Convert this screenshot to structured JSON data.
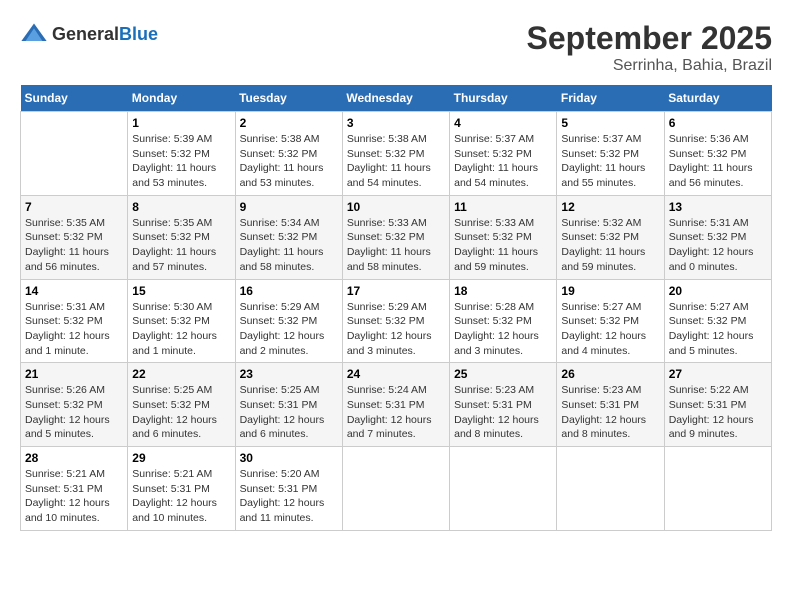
{
  "logo": {
    "text_general": "General",
    "text_blue": "Blue"
  },
  "title": {
    "month": "September 2025",
    "location": "Serrinha, Bahia, Brazil"
  },
  "weekdays": [
    "Sunday",
    "Monday",
    "Tuesday",
    "Wednesday",
    "Thursday",
    "Friday",
    "Saturday"
  ],
  "weeks": [
    [
      {
        "day": "",
        "info": ""
      },
      {
        "day": "1",
        "info": "Sunrise: 5:39 AM\nSunset: 5:32 PM\nDaylight: 11 hours\nand 53 minutes."
      },
      {
        "day": "2",
        "info": "Sunrise: 5:38 AM\nSunset: 5:32 PM\nDaylight: 11 hours\nand 53 minutes."
      },
      {
        "day": "3",
        "info": "Sunrise: 5:38 AM\nSunset: 5:32 PM\nDaylight: 11 hours\nand 54 minutes."
      },
      {
        "day": "4",
        "info": "Sunrise: 5:37 AM\nSunset: 5:32 PM\nDaylight: 11 hours\nand 54 minutes."
      },
      {
        "day": "5",
        "info": "Sunrise: 5:37 AM\nSunset: 5:32 PM\nDaylight: 11 hours\nand 55 minutes."
      },
      {
        "day": "6",
        "info": "Sunrise: 5:36 AM\nSunset: 5:32 PM\nDaylight: 11 hours\nand 56 minutes."
      }
    ],
    [
      {
        "day": "7",
        "info": "Sunrise: 5:35 AM\nSunset: 5:32 PM\nDaylight: 11 hours\nand 56 minutes."
      },
      {
        "day": "8",
        "info": "Sunrise: 5:35 AM\nSunset: 5:32 PM\nDaylight: 11 hours\nand 57 minutes."
      },
      {
        "day": "9",
        "info": "Sunrise: 5:34 AM\nSunset: 5:32 PM\nDaylight: 11 hours\nand 58 minutes."
      },
      {
        "day": "10",
        "info": "Sunrise: 5:33 AM\nSunset: 5:32 PM\nDaylight: 11 hours\nand 58 minutes."
      },
      {
        "day": "11",
        "info": "Sunrise: 5:33 AM\nSunset: 5:32 PM\nDaylight: 11 hours\nand 59 minutes."
      },
      {
        "day": "12",
        "info": "Sunrise: 5:32 AM\nSunset: 5:32 PM\nDaylight: 11 hours\nand 59 minutes."
      },
      {
        "day": "13",
        "info": "Sunrise: 5:31 AM\nSunset: 5:32 PM\nDaylight: 12 hours\nand 0 minutes."
      }
    ],
    [
      {
        "day": "14",
        "info": "Sunrise: 5:31 AM\nSunset: 5:32 PM\nDaylight: 12 hours\nand 1 minute."
      },
      {
        "day": "15",
        "info": "Sunrise: 5:30 AM\nSunset: 5:32 PM\nDaylight: 12 hours\nand 1 minute."
      },
      {
        "day": "16",
        "info": "Sunrise: 5:29 AM\nSunset: 5:32 PM\nDaylight: 12 hours\nand 2 minutes."
      },
      {
        "day": "17",
        "info": "Sunrise: 5:29 AM\nSunset: 5:32 PM\nDaylight: 12 hours\nand 3 minutes."
      },
      {
        "day": "18",
        "info": "Sunrise: 5:28 AM\nSunset: 5:32 PM\nDaylight: 12 hours\nand 3 minutes."
      },
      {
        "day": "19",
        "info": "Sunrise: 5:27 AM\nSunset: 5:32 PM\nDaylight: 12 hours\nand 4 minutes."
      },
      {
        "day": "20",
        "info": "Sunrise: 5:27 AM\nSunset: 5:32 PM\nDaylight: 12 hours\nand 5 minutes."
      }
    ],
    [
      {
        "day": "21",
        "info": "Sunrise: 5:26 AM\nSunset: 5:32 PM\nDaylight: 12 hours\nand 5 minutes."
      },
      {
        "day": "22",
        "info": "Sunrise: 5:25 AM\nSunset: 5:32 PM\nDaylight: 12 hours\nand 6 minutes."
      },
      {
        "day": "23",
        "info": "Sunrise: 5:25 AM\nSunset: 5:31 PM\nDaylight: 12 hours\nand 6 minutes."
      },
      {
        "day": "24",
        "info": "Sunrise: 5:24 AM\nSunset: 5:31 PM\nDaylight: 12 hours\nand 7 minutes."
      },
      {
        "day": "25",
        "info": "Sunrise: 5:23 AM\nSunset: 5:31 PM\nDaylight: 12 hours\nand 8 minutes."
      },
      {
        "day": "26",
        "info": "Sunrise: 5:23 AM\nSunset: 5:31 PM\nDaylight: 12 hours\nand 8 minutes."
      },
      {
        "day": "27",
        "info": "Sunrise: 5:22 AM\nSunset: 5:31 PM\nDaylight: 12 hours\nand 9 minutes."
      }
    ],
    [
      {
        "day": "28",
        "info": "Sunrise: 5:21 AM\nSunset: 5:31 PM\nDaylight: 12 hours\nand 10 minutes."
      },
      {
        "day": "29",
        "info": "Sunrise: 5:21 AM\nSunset: 5:31 PM\nDaylight: 12 hours\nand 10 minutes."
      },
      {
        "day": "30",
        "info": "Sunrise: 5:20 AM\nSunset: 5:31 PM\nDaylight: 12 hours\nand 11 minutes."
      },
      {
        "day": "",
        "info": ""
      },
      {
        "day": "",
        "info": ""
      },
      {
        "day": "",
        "info": ""
      },
      {
        "day": "",
        "info": ""
      }
    ]
  ]
}
